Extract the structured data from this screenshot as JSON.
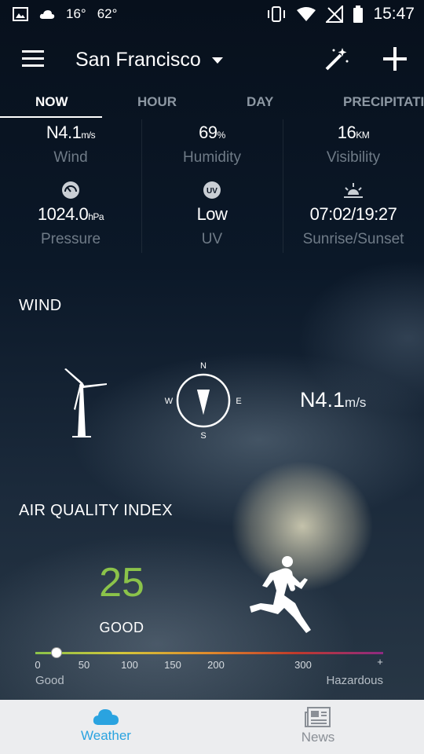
{
  "status_bar": {
    "temp_c": "16°",
    "temp_f": "62°",
    "time": "15:47"
  },
  "header": {
    "city": "San Francisco"
  },
  "tabs": [
    {
      "label": "NOW",
      "active": true
    },
    {
      "label": "HOUR"
    },
    {
      "label": "DAY"
    },
    {
      "label": "PRECIPITATI"
    }
  ],
  "stats": {
    "wind": {
      "value": "N4.1",
      "unit": "m/s",
      "label": "Wind"
    },
    "humidity": {
      "value": "69",
      "unit": "%",
      "label": "Humidity"
    },
    "visibility": {
      "value": "16",
      "unit": "KM",
      "label": "Visibility"
    },
    "pressure": {
      "value": "1024.0",
      "unit": "hPa",
      "label": "Pressure",
      "icon": "gauge-icon"
    },
    "uv": {
      "value": "Low",
      "label": "UV",
      "icon": "uv-icon",
      "icon_text": "UV"
    },
    "sun": {
      "value": "07:02/19:27",
      "label": "Sunrise/Sunset",
      "icon": "sunrise-icon"
    }
  },
  "wind_section": {
    "title": "WIND",
    "compass": {
      "n": "N",
      "e": "E",
      "s": "S",
      "w": "W"
    },
    "value": "N4.1",
    "unit": "m/s"
  },
  "aqi_section": {
    "title": "AIR QUALITY INDEX",
    "value": "25",
    "level": "GOOD",
    "value_color": "#8bc34a",
    "scale_ticks": [
      "0",
      "50",
      "100",
      "150",
      "200",
      "300",
      "+"
    ],
    "scale_start_label": "Good",
    "scale_end_label": "Hazardous",
    "scale_colors": [
      "#8bc34a",
      "#d4c63a",
      "#e08a2c",
      "#c0392b",
      "#8e2a82"
    ]
  },
  "bottom_nav": [
    {
      "label": "Weather",
      "icon": "cloud-icon",
      "active": true,
      "color": "#2aa3e0"
    },
    {
      "label": "News",
      "icon": "newspaper-icon",
      "color": "#8a8f96"
    }
  ]
}
